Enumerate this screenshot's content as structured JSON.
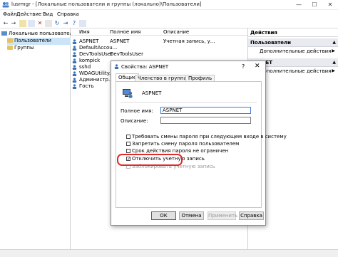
{
  "window": {
    "title": "lusrmgr - [Локальные пользователи и группы (локально)\\Пользователи]",
    "controls": {
      "minimize": "—",
      "maximize": "☐",
      "close": "✕"
    }
  },
  "menu": [
    "Файл",
    "Действие",
    "Вид",
    "Справка"
  ],
  "tree": {
    "root": "Локальные пользователи и гр",
    "items": [
      "Пользователи",
      "Группы"
    ]
  },
  "list": {
    "headers": {
      "name": "Имя",
      "fullname": "Полное имя",
      "desc": "Описание"
    },
    "rows": [
      {
        "name": "ASPNET",
        "fullname": "ASPNET",
        "desc": "Учетная запись, у..."
      },
      {
        "name": "DefaultAccou...",
        "fullname": "",
        "desc": ""
      },
      {
        "name": "DevToolsUser",
        "fullname": "DevToolsUser",
        "desc": ""
      },
      {
        "name": "kompick",
        "fullname": "",
        "desc": ""
      },
      {
        "name": "sshd",
        "fullname": "",
        "desc": ""
      },
      {
        "name": "WDAGUtility...",
        "fullname": "",
        "desc": ""
      },
      {
        "name": "Администр...",
        "fullname": "",
        "desc": ""
      },
      {
        "name": "Гость",
        "fullname": "",
        "desc": ""
      }
    ]
  },
  "actions": {
    "header": "Действия",
    "section1": "Пользователи",
    "section1_item": "Дополнительные действия",
    "section2": "ASPNET",
    "section2_item": "Дополнительные действия"
  },
  "dialog": {
    "title": "Свойства: ASPNET",
    "help": "?",
    "close": "✕",
    "tabs": [
      "Общие",
      "Членство в группах",
      "Профиль"
    ],
    "account_name": "ASPNET",
    "fullname_label": "Полное имя:",
    "fullname_value": "ASPNET",
    "desc_label": "Описание:",
    "desc_value": "",
    "checkboxes": [
      {
        "label": "Требовать смены пароля при следующем входе в систему",
        "checked": false
      },
      {
        "label": "Запретить смену пароля пользователем",
        "checked": false
      },
      {
        "label": "Срок действия пароля не ограничен",
        "checked": false
      },
      {
        "label": "Отключить учетную запись",
        "checked": true
      },
      {
        "label": "Заблокировать учетную запись",
        "checked": false
      }
    ],
    "buttons": {
      "ok": "ОК",
      "cancel": "Отмена",
      "apply": "Применить",
      "help": "Справка"
    }
  },
  "colors": {
    "highlight": "#e02a2a",
    "selection": "#cce4f7",
    "accent": "#0078d7"
  }
}
